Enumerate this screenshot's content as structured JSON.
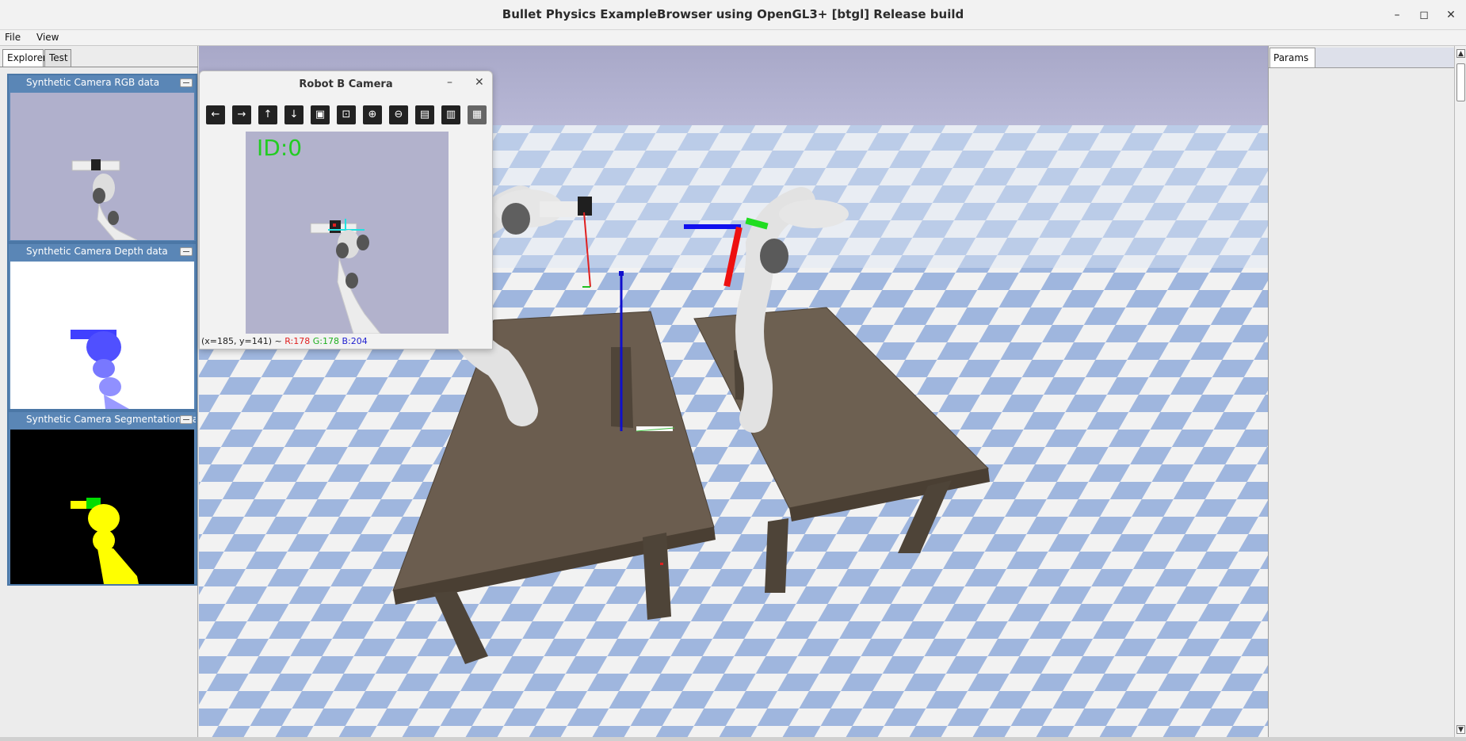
{
  "window": {
    "title": "Bullet Physics ExampleBrowser using OpenGL3+ [btgl] Release build",
    "controls": {
      "minimize": "–",
      "maximize": "◻",
      "close": "✕"
    }
  },
  "menu": {
    "file": "File",
    "view": "View"
  },
  "left_panel": {
    "tabs": [
      {
        "label": "Explorer"
      },
      {
        "label": "Test"
      }
    ],
    "camera_panels": [
      {
        "title": "Synthetic Camera RGB data"
      },
      {
        "title": "Synthetic Camera Depth data"
      },
      {
        "title": "Synthetic Camera Segmentation Mask"
      }
    ]
  },
  "robot_camera": {
    "title": "Robot B Camera",
    "controls": {
      "minimize": "–",
      "close": "✕"
    },
    "toolbar": [
      {
        "icon": "arrow-left-icon",
        "glyph": "←"
      },
      {
        "icon": "arrow-right-icon",
        "glyph": "→"
      },
      {
        "icon": "arrow-up-icon",
        "glyph": "↑"
      },
      {
        "icon": "arrow-down-icon",
        "glyph": "↓"
      },
      {
        "icon": "image-icon",
        "glyph": "▣"
      },
      {
        "icon": "image-search-icon",
        "glyph": "⊡"
      },
      {
        "icon": "zoom-in-icon",
        "glyph": "⊕"
      },
      {
        "icon": "zoom-out-icon",
        "glyph": "⊖"
      },
      {
        "icon": "save-icon",
        "glyph": "▤"
      },
      {
        "icon": "clipboard-icon",
        "glyph": "▥"
      },
      {
        "icon": "save-as-icon",
        "glyph": "▦"
      }
    ],
    "image_label": "ID:0",
    "status": {
      "coords": "(x=185, y=141) ~",
      "r": "R:178",
      "g": "G:178",
      "b": "B:204"
    }
  },
  "right_panel": {
    "tab": "Params"
  },
  "scrollbar": {
    "up": "▲",
    "down": "▼"
  }
}
